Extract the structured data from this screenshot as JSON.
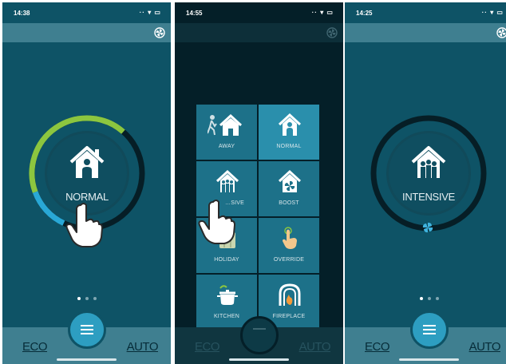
{
  "colors": {
    "background": "#0e5366",
    "bar": "#3f7f90",
    "ring_green": "#8cc63f",
    "ring_blue": "#29a8d6",
    "ring_dark": "#061e26",
    "menu_button": "#2d9ec1"
  },
  "screens": [
    {
      "status_time": "14:38",
      "mode_label": "NORMAL",
      "mode_icon": "person-house-icon",
      "ring_level": 0.42,
      "page_dots": 3,
      "active_dot": 0,
      "bottom": {
        "eco": "ECO",
        "auto": "AUTO"
      }
    },
    {
      "status_time": "14:55",
      "modes": [
        {
          "label": "AWAY",
          "icon": "walking-person-house-icon"
        },
        {
          "label": "NORMAL",
          "icon": "person-house-icon",
          "selected": true
        },
        {
          "label": "…SIVE",
          "icon": "group-house-icon"
        },
        {
          "label": "BOOST",
          "icon": "fan-house-icon"
        },
        {
          "label": "HOLIDAY",
          "icon": "suitcase-icon"
        },
        {
          "label": "OVERRIDE",
          "icon": "finger-touch-icon"
        },
        {
          "label": "KITCHEN",
          "icon": "cooking-pot-icon"
        },
        {
          "label": "FIREPLACE",
          "icon": "fireplace-icon"
        }
      ],
      "bottom": {
        "eco": "ECO",
        "auto": "AUTO"
      }
    },
    {
      "status_time": "14:25",
      "mode_label": "INTENSIVE",
      "mode_icon": "group-house-icon",
      "ring_level": 0,
      "page_dots": 3,
      "active_dot": 0,
      "bottom": {
        "eco": "ECO",
        "auto": "AUTO"
      }
    }
  ]
}
